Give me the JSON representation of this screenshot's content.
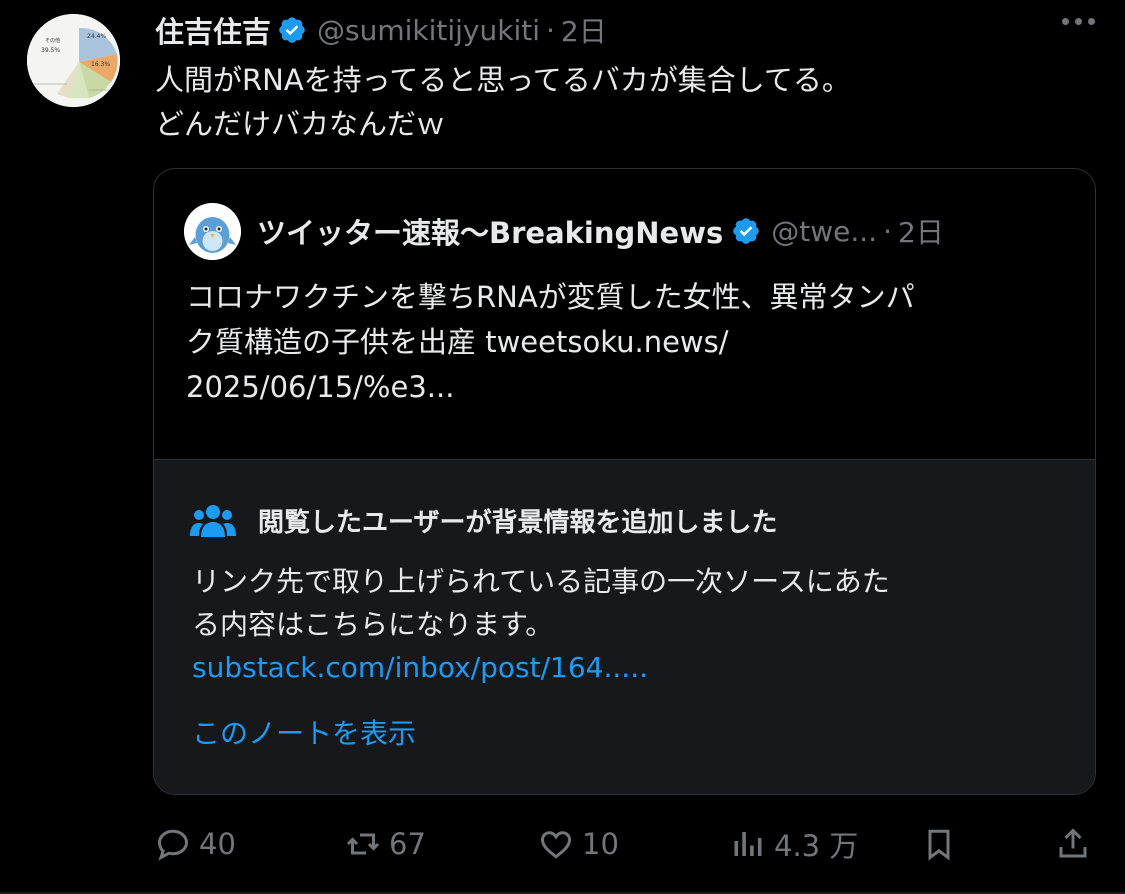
{
  "tweet": {
    "display_name": "住吉住吉",
    "handle": "@sumikitijyukiti",
    "separator": "·",
    "time": "2日",
    "text_lines": [
      "人間がRNAを持ってると思ってるバカが集合してる。",
      "どんだけバカなんだｗ"
    ],
    "avatar_chart_labels": {
      "label_1": "その他",
      "value_1": "39.5%",
      "value_2": "24.4%",
      "value_3": "16.3%"
    }
  },
  "quote": {
    "display_name": "ツイッター速報〜BreakingNews",
    "handle": "@twe...",
    "separator": "·",
    "time": "2日",
    "text_lines": [
      "コロナワクチンを撃ちRNAが変質した女性、異常タンパ",
      "ク質構造の子供を出産 tweetsoku.news/",
      "2025/06/15/%e3..."
    ]
  },
  "community_note": {
    "title": "閲覧したユーザーが背景情報を追加しました",
    "body_lines": [
      "リンク先で取り上げられている記事の一次ソースにあた",
      "る内容はこちらになります。"
    ],
    "link": "substack.com/inbox/post/164.....",
    "cta": "このノートを表示"
  },
  "actions": {
    "replies": "40",
    "retweets": "67",
    "likes": "10",
    "views": "4.3 万"
  },
  "colors": {
    "background": "#000000",
    "text": "#e7e9ea",
    "muted": "#71767b",
    "accent": "#1d9bf0",
    "note_bg": "#16181c"
  }
}
